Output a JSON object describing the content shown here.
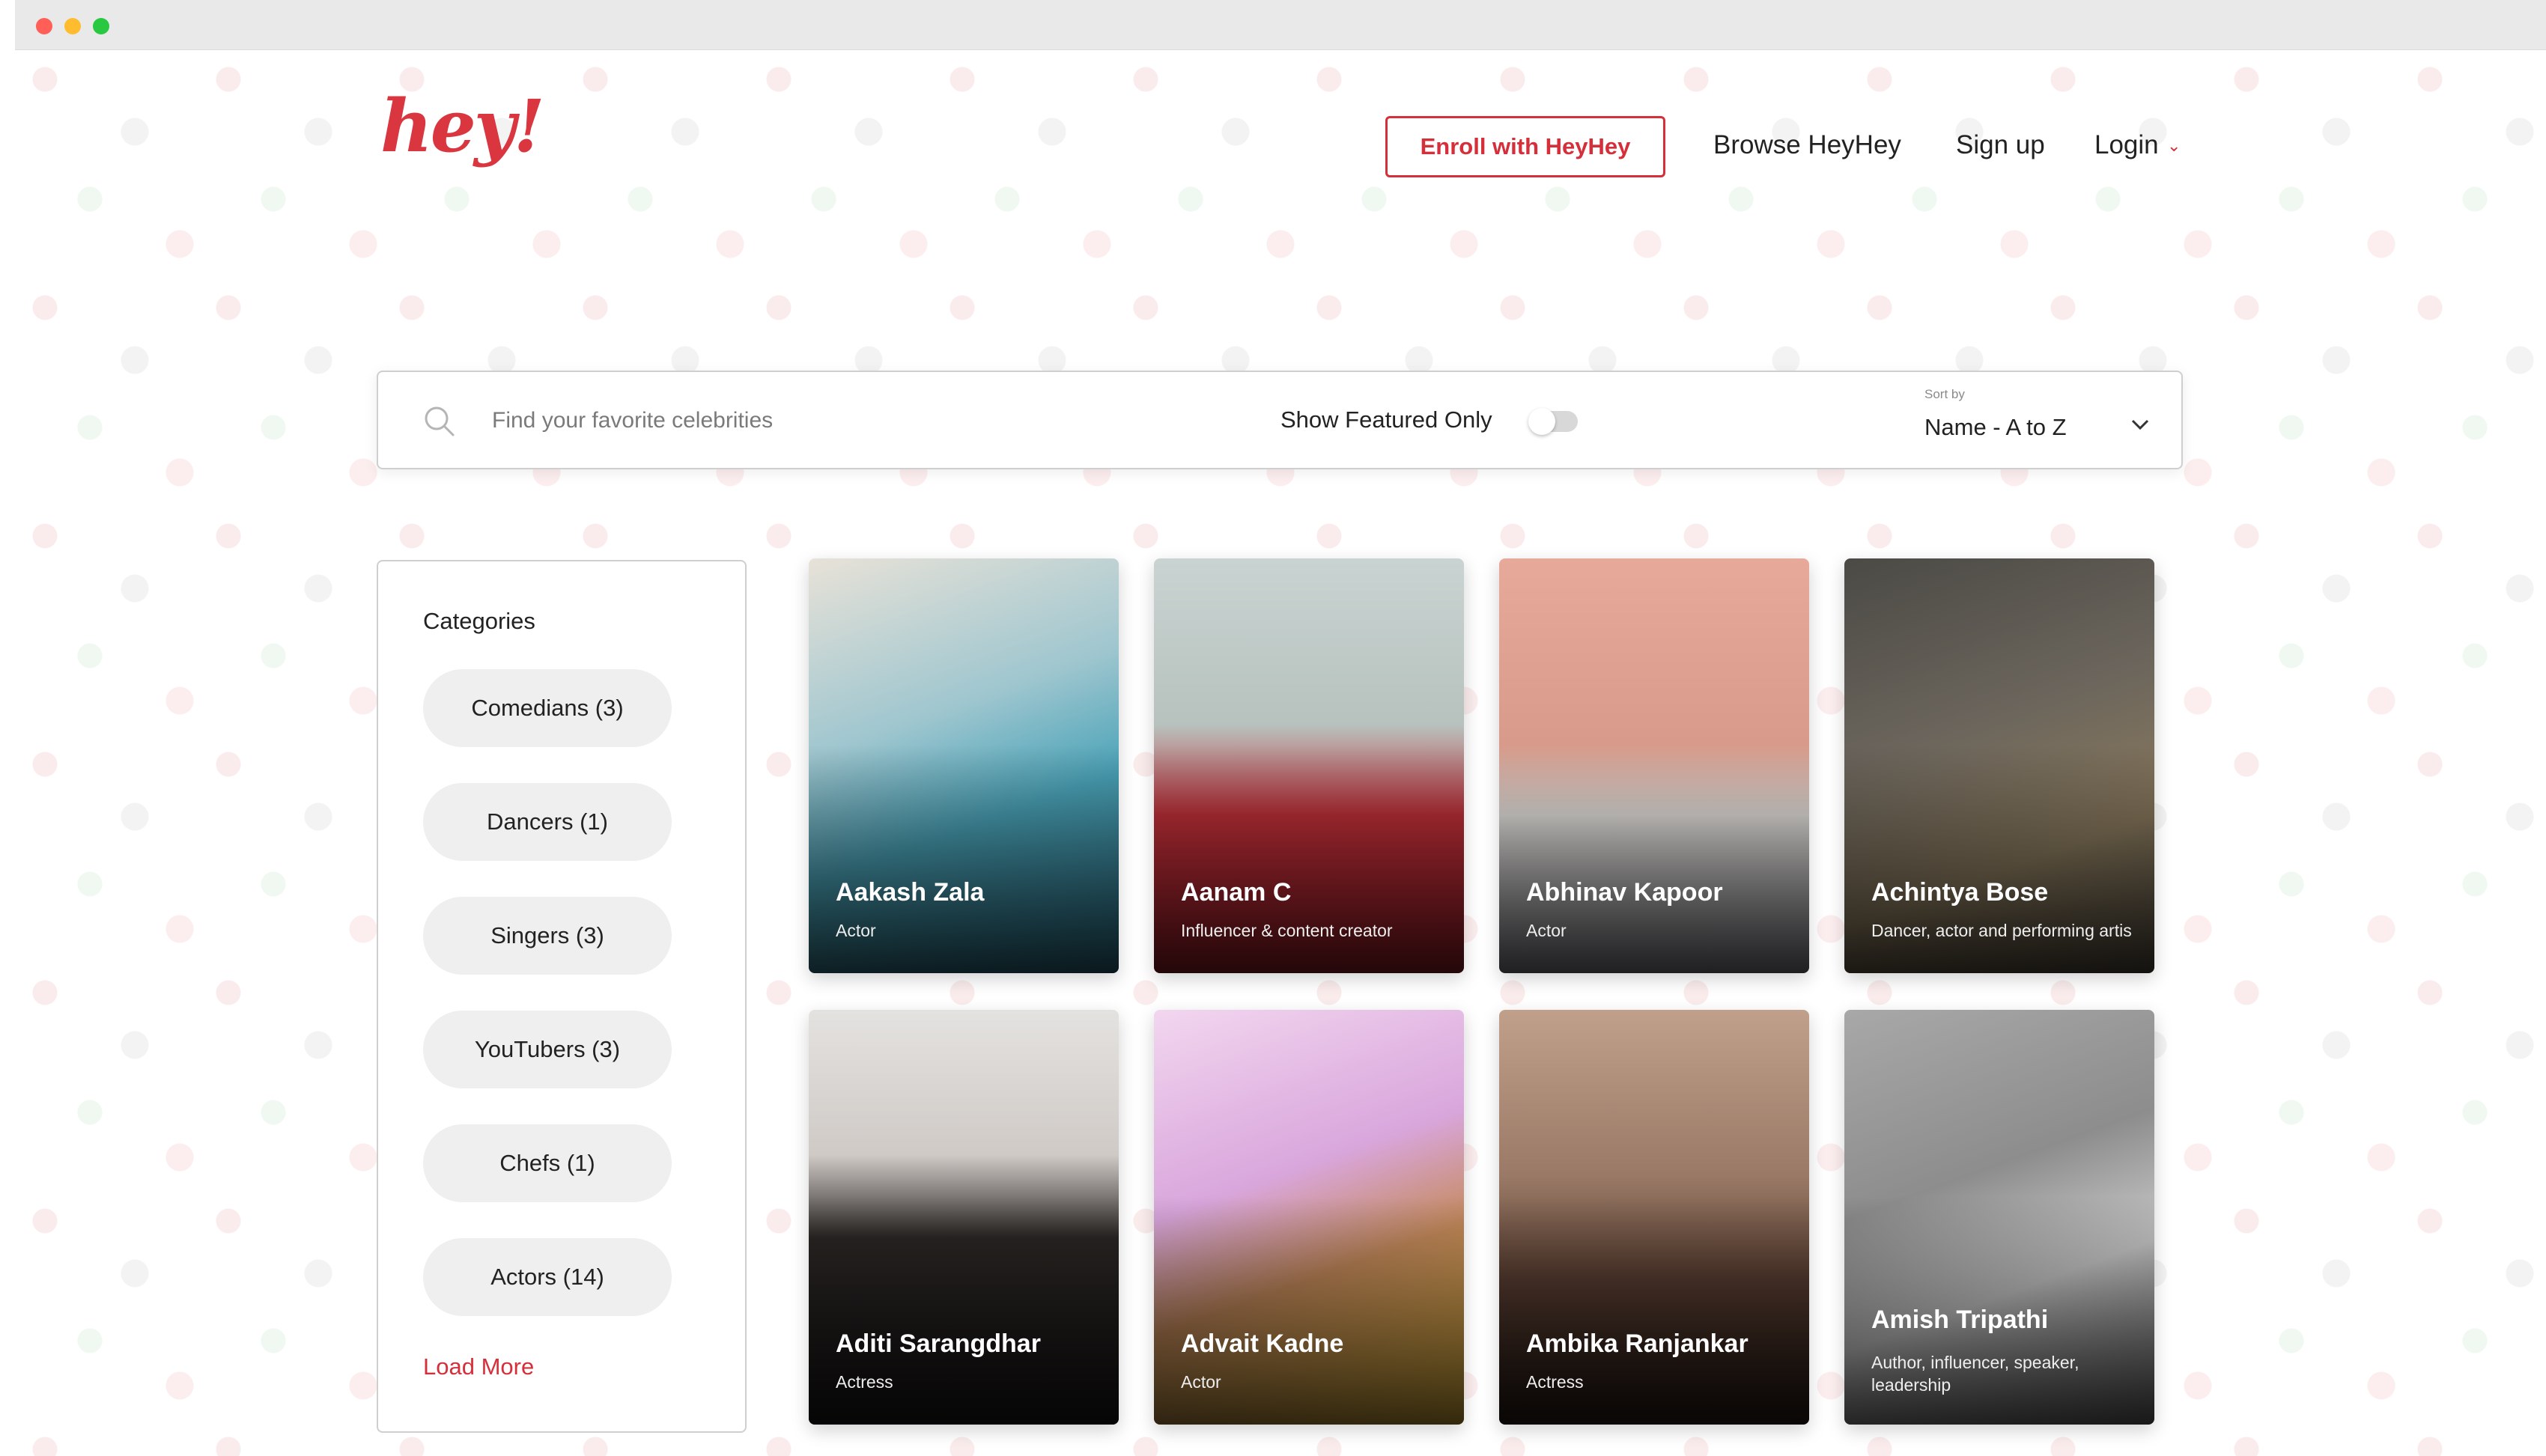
{
  "window": {
    "controls": [
      "close",
      "minimize",
      "maximize"
    ]
  },
  "header": {
    "logo_text": "hey!",
    "enroll_label": "Enroll with HeyHey",
    "nav": {
      "browse": "Browse HeyHey",
      "signup": "Sign up",
      "login": "Login"
    }
  },
  "search": {
    "placeholder": "Find your favorite celebrities",
    "featured_label": "Show Featured Only",
    "featured_on": false,
    "sort_caption": "Sort by",
    "sort_value": "Name - A to Z"
  },
  "categories": {
    "title": "Categories",
    "items": [
      {
        "label": "Comedians (3)"
      },
      {
        "label": "Dancers (1)"
      },
      {
        "label": "Singers (3)"
      },
      {
        "label": "YouTubers (3)"
      },
      {
        "label": "Chefs (1)"
      },
      {
        "label": "Actors (14)"
      }
    ],
    "load_more": "Load More"
  },
  "celebrities": [
    {
      "name": "Aakash Zala",
      "role": "Actor"
    },
    {
      "name": "Aanam C",
      "role": "Influencer & content creator"
    },
    {
      "name": "Abhinav Kapoor",
      "role": "Actor"
    },
    {
      "name": "Achintya Bose",
      "role": "Dancer, actor and performing artis"
    },
    {
      "name": "Aditi Sarangdhar",
      "role": "Actress"
    },
    {
      "name": "Advait Kadne",
      "role": "Actor"
    },
    {
      "name": "Ambika Ranjankar",
      "role": "Actress"
    },
    {
      "name": "Amish Tripathi",
      "role": "Author, influencer, speaker, leadership"
    }
  ],
  "colors": {
    "brand": "#d52f3a"
  }
}
